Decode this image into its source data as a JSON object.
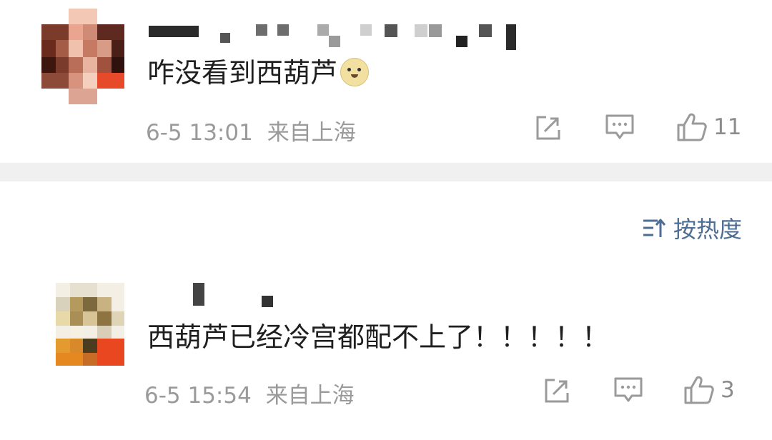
{
  "comments": [
    {
      "text": "咋没看到西葫芦",
      "date": "6-5 13:01",
      "location": "来自上海",
      "like_count": "11",
      "emoji": "doge-emoji"
    },
    {
      "text": "西葫芦已经冷宫都配不上了！！！！！",
      "date": "6-5 15:54",
      "location": "来自上海",
      "like_count": "3"
    }
  ],
  "sort": {
    "label": "按热度",
    "icon": "sort-icon"
  },
  "icons": {
    "share": "share-icon",
    "comment": "comment-icon",
    "like": "thumbs-up-icon"
  },
  "colors": {
    "accent": "#4c6d94",
    "meta": "#9a9a9a",
    "divider": "#f0f0f0"
  }
}
